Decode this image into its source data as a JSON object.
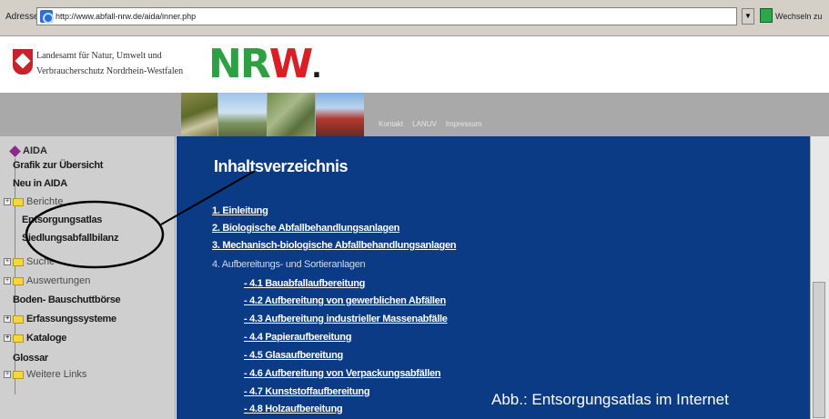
{
  "address_bar": {
    "label": "Adresse",
    "url": "http://www.abfall-nrw.de/aida/inner.php",
    "go_label": "Wechseln zu"
  },
  "header": {
    "agency_line1": "Landesamt für Natur, Umwelt und",
    "agency_line2": "Verbraucherschutz Nordrhein-Westfalen",
    "logo_n": "N",
    "logo_r": "R",
    "logo_w": "W",
    "logo_dot": "."
  },
  "banner": {
    "nav": [
      "Kontakt",
      "LANUV",
      "Impressum"
    ]
  },
  "sidebar": {
    "title": "AIDA",
    "items": [
      {
        "label": "Grafik zur Übersicht"
      },
      {
        "label": "Neu in AIDA"
      },
      {
        "label": "Berichte"
      },
      {
        "label": "Entsorgungsatlas"
      },
      {
        "label": "Siedlungsabfallbilanz"
      },
      {
        "label": "Suche"
      },
      {
        "label": "Auswertungen"
      },
      {
        "label": "Boden- Bauschuttbörse"
      },
      {
        "label": "Erfassungssysteme"
      },
      {
        "label": "Kataloge"
      },
      {
        "label": "Glossar"
      },
      {
        "label": "Weitere Links"
      }
    ]
  },
  "main": {
    "title": "Inhaltsverzeichnis",
    "toc": [
      "1. Einleitung",
      "2. Biologische Abfallbehandlungsanlagen",
      "3. Mechanisch-biologische Abfallbehandlungsanlagen",
      "4. Aufbereitungs- und Sortieranlagen",
      "- 4.1 Bauabfallaufbereitung",
      "- 4.2 Aufbereitung von gewerblichen Abfällen",
      "- 4.3 Aufbereitung industrieller Massenabfälle",
      "- 4.4 Papieraufbereitung",
      "- 4.5 Glasaufbereitung",
      "- 4.6 Aufbereitung von Verpackungsabfällen",
      "- 4.7 Kunststoffaufbereitung",
      "- 4.8 Holzaufbereitung"
    ],
    "caption": "Abb.: Entsorgungsatlas im Internet"
  },
  "colors": {
    "content_bg": "#0b3b84",
    "sidebar_bg": "#cfcfcf",
    "banner_bg": "#a9a9a9",
    "logo_green": "#2ea043",
    "logo_red": "#d91e25"
  }
}
